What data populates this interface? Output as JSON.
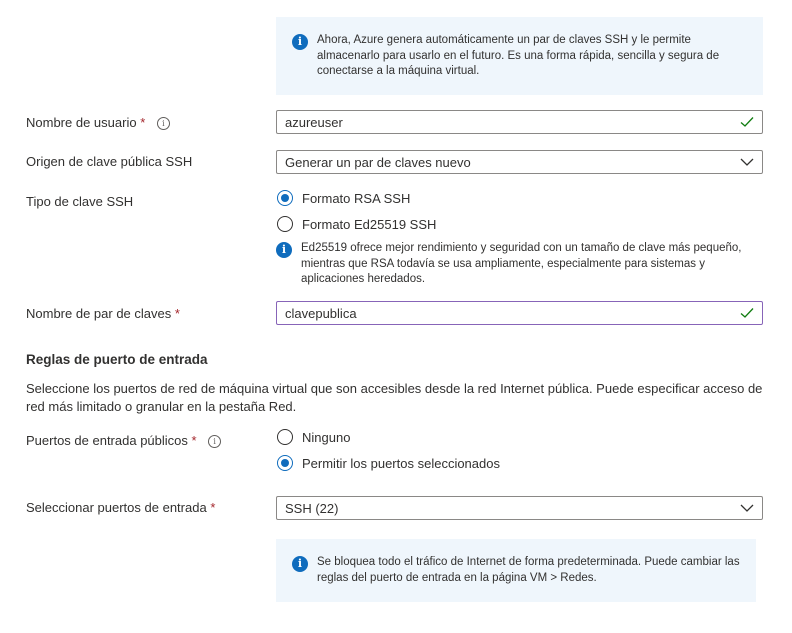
{
  "top_info": {
    "text": "Ahora, Azure genera automáticamente un par de claves SSH y le permite almacenarlo para usarlo en el futuro. Es una forma rápida, sencilla y segura de conectarse a la máquina virtual."
  },
  "username": {
    "label": "Nombre de usuario",
    "required": "*",
    "tooltip": "i",
    "value": "azureuser"
  },
  "ssh_key_source": {
    "label": "Origen de clave pública SSH",
    "value": "Generar un par de claves nuevo"
  },
  "ssh_key_type": {
    "label": "Tipo de clave SSH",
    "options": [
      "Formato RSA SSH",
      "Formato Ed25519 SSH"
    ],
    "selected": "Formato RSA SSH",
    "info": "Ed25519 ofrece mejor rendimiento y seguridad con un tamaño de clave más pequeño, mientras que RSA todavía se usa ampliamente, especialmente para sistemas y aplicaciones heredados."
  },
  "key_pair_name": {
    "label": "Nombre de par de claves",
    "required": "*",
    "value": "clavepublica"
  },
  "inbound_rules": {
    "title": "Reglas de puerto de entrada",
    "description": "Seleccione los puertos de red de máquina virtual que son accesibles desde la red Internet pública. Puede especificar acceso de red más limitado o granular en la pestaña Red."
  },
  "public_inbound_ports": {
    "label": "Puertos de entrada públicos",
    "required": "*",
    "tooltip": "i",
    "options": [
      "Ninguno",
      "Permitir los puertos seleccionados"
    ],
    "selected": "Permitir los puertos seleccionados"
  },
  "select_inbound_ports": {
    "label": "Seleccionar puertos de entrada",
    "required": "*",
    "value": "SSH (22)"
  },
  "bottom_info": {
    "text": "Se bloquea todo el tráfico de Internet de forma predeterminada. Puede cambiar las reglas del puerto de entrada en la página VM > Redes."
  },
  "colors": {
    "info_bg": "#eff6fc",
    "accent": "#0f6cbd",
    "required": "#a4262c",
    "valid_check": "#107c10",
    "focus_border": "#8764b8"
  }
}
